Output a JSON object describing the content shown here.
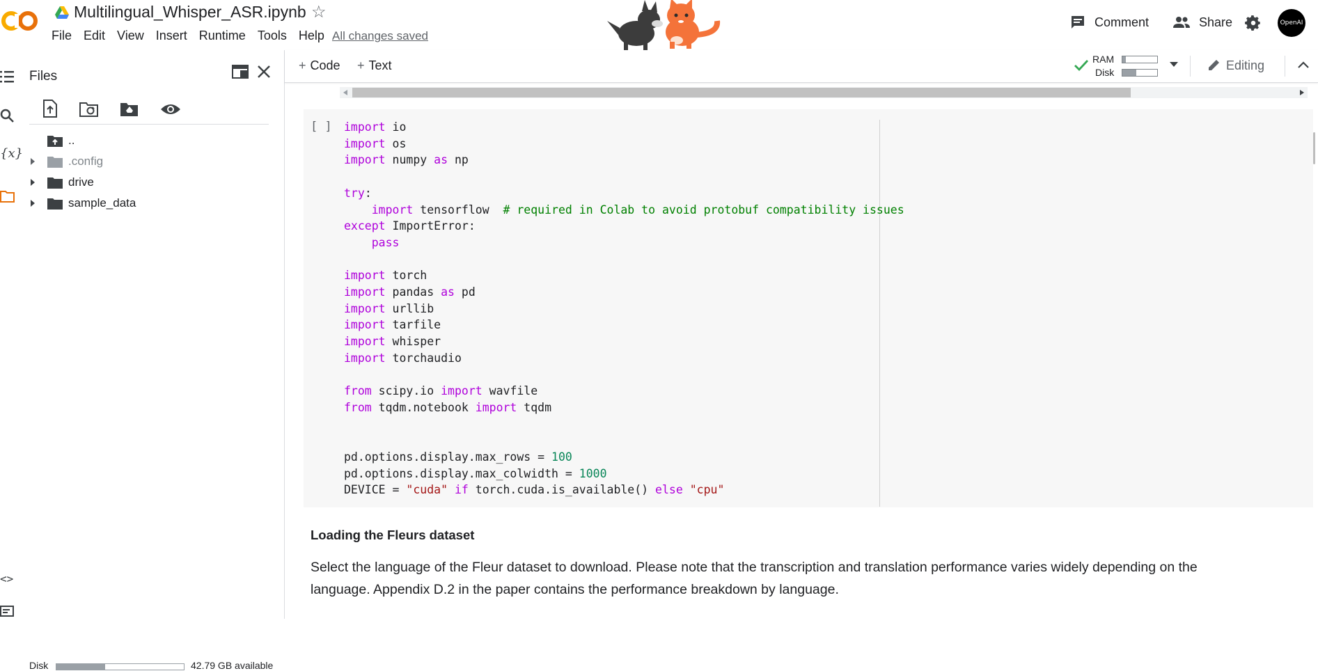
{
  "header": {
    "notebook_title": "Multilingual_Whisper_ASR.ipynb",
    "menu": [
      "File",
      "Edit",
      "View",
      "Insert",
      "Runtime",
      "Tools",
      "Help"
    ],
    "save_status": "All changes saved",
    "comment_label": "Comment",
    "share_label": "Share",
    "avatar_text": "OpenAI"
  },
  "files_panel": {
    "title": "Files",
    "tree": [
      {
        "label": "..",
        "type": "parent"
      },
      {
        "label": ".config",
        "type": "folder",
        "dimmed": true
      },
      {
        "label": "drive",
        "type": "folder",
        "dimmed": false
      },
      {
        "label": "sample_data",
        "type": "folder",
        "dimmed": false
      }
    ],
    "disk_label": "Disk",
    "disk_available": "42.79 GB available",
    "disk_used_fraction": 0.38
  },
  "toolbar": {
    "code_label": "Code",
    "text_label": "Text",
    "ram_label": "RAM",
    "disk_label": "Disk",
    "ram_fraction": 0.1,
    "disk_fraction": 0.4,
    "editing_label": "Editing"
  },
  "code_cell": {
    "exec_count": "[ ]"
  },
  "text_cell": {
    "heading": "Loading the Fleurs dataset",
    "paragraph": "Select the language of the Fleur dataset to download. Please note that the transcription and translation performance varies widely depending on the language. Appendix D.2 in the paper contains the performance breakdown by language."
  },
  "colors": {
    "keyword": "#af00db",
    "comment": "#008000",
    "string": "#a31515",
    "number": "#098658",
    "check": "#34a853",
    "logo_orange": "#f9ab00",
    "logo_dark_orange": "#e8710a"
  }
}
